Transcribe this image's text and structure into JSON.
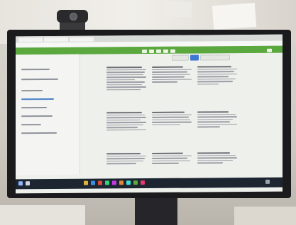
{
  "scene": "photo-of-monitor",
  "colors": {
    "app_green": "#5aa83e",
    "taskbar": "#1d2531",
    "accent_blue": "#3f78d1"
  },
  "icons": [
    "webcam-icon",
    "monitor-logo-icon"
  ]
}
